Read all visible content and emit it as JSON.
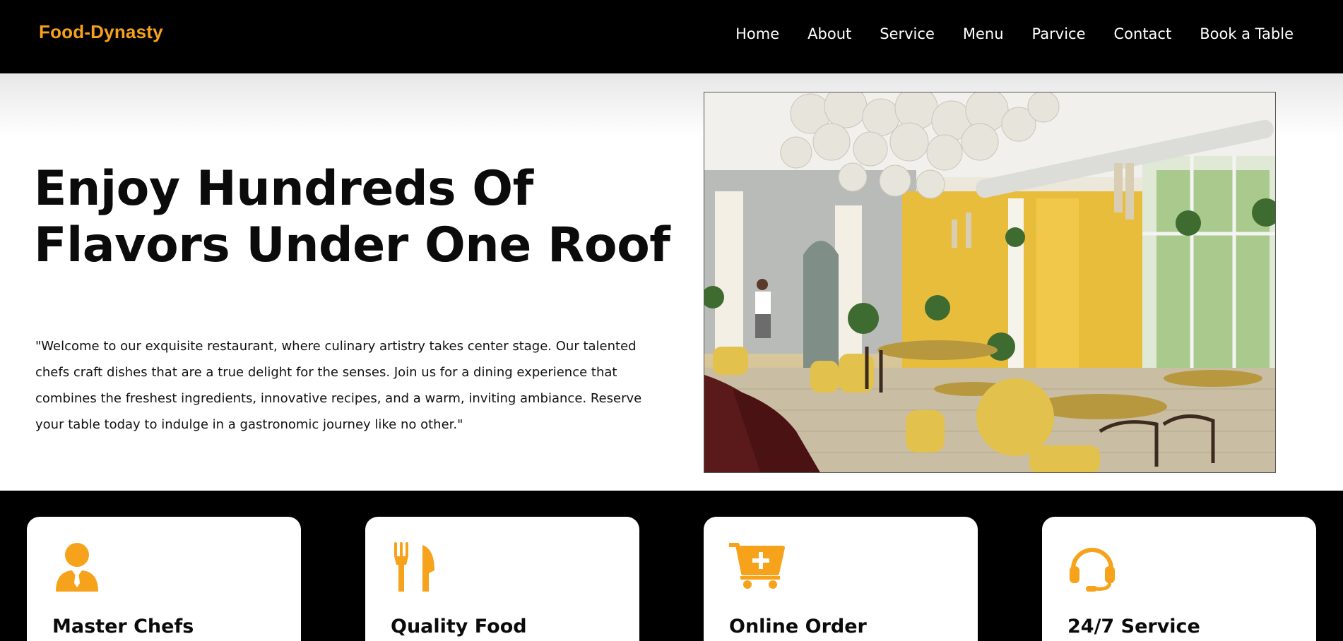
{
  "brand": "Food-Dynasty",
  "nav": [
    "Home",
    "About",
    "Service",
    "Menu",
    "Parvice",
    "Contact",
    "Book a Table"
  ],
  "hero": {
    "title": "Enjoy Hundreds Of Flavors Under One Roof",
    "text": "\"Welcome to our exquisite restaurant, where culinary artistry takes center stage. Our talented chefs craft dishes that are a true delight for the senses. Join us for a dining experience that combines the freshest ingredients, innovative recipes, and a warm, inviting ambiance. Reserve your table today to indulge in a gastronomic journey like no other.\""
  },
  "services": [
    {
      "title": "Master Chefs",
      "icon": "chef-icon"
    },
    {
      "title": "Quality Food",
      "icon": "fork-knife-icon"
    },
    {
      "title": "Online Order",
      "icon": "cart-plus-icon"
    },
    {
      "title": "24/7 Service",
      "icon": "headset-icon"
    }
  ],
  "colors": {
    "accent": "#f7a21b",
    "dark": "#000000",
    "background": "#ffffff"
  }
}
